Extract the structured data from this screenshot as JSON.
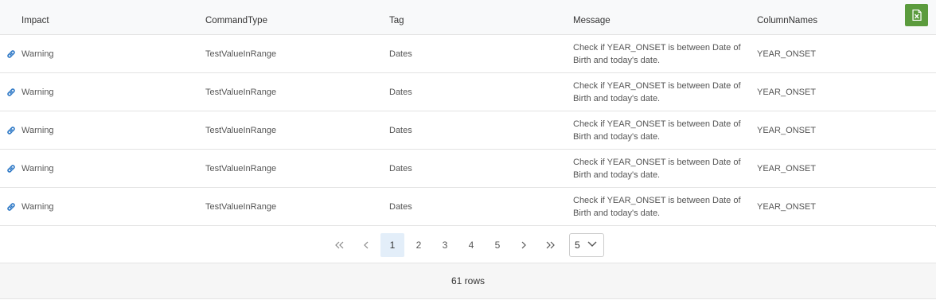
{
  "columns": {
    "impact": "Impact",
    "command_type": "CommandType",
    "tag": "Tag",
    "message": "Message",
    "column_names": "ColumnNames"
  },
  "export_icon": "excel-export-icon",
  "rows": [
    {
      "impact": "Warning",
      "command_type": "TestValueInRange",
      "tag": "Dates",
      "message": "Check if YEAR_ONSET is between Date of Birth and today's date.",
      "column_names": "YEAR_ONSET"
    },
    {
      "impact": "Warning",
      "command_type": "TestValueInRange",
      "tag": "Dates",
      "message": "Check if YEAR_ONSET is between Date of Birth and today's date.",
      "column_names": "YEAR_ONSET"
    },
    {
      "impact": "Warning",
      "command_type": "TestValueInRange",
      "tag": "Dates",
      "message": "Check if YEAR_ONSET is between Date of Birth and today's date.",
      "column_names": "YEAR_ONSET"
    },
    {
      "impact": "Warning",
      "command_type": "TestValueInRange",
      "tag": "Dates",
      "message": "Check if YEAR_ONSET is between Date of Birth and today's date.",
      "column_names": "YEAR_ONSET"
    },
    {
      "impact": "Warning",
      "command_type": "TestValueInRange",
      "tag": "Dates",
      "message": "Check if YEAR_ONSET is between Date of Birth and today's date.",
      "column_names": "YEAR_ONSET"
    }
  ],
  "pagination": {
    "first": "«",
    "prev": "‹",
    "pages": [
      "1",
      "2",
      "3",
      "4",
      "5"
    ],
    "active_page": "1",
    "next": "›",
    "last": "»",
    "page_size": "5"
  },
  "footer": {
    "row_count": "61 rows"
  },
  "colors": {
    "accent_green": "#5b9b3d",
    "link_blue": "#2f79c6",
    "active_page_bg": "#e3eef9"
  }
}
